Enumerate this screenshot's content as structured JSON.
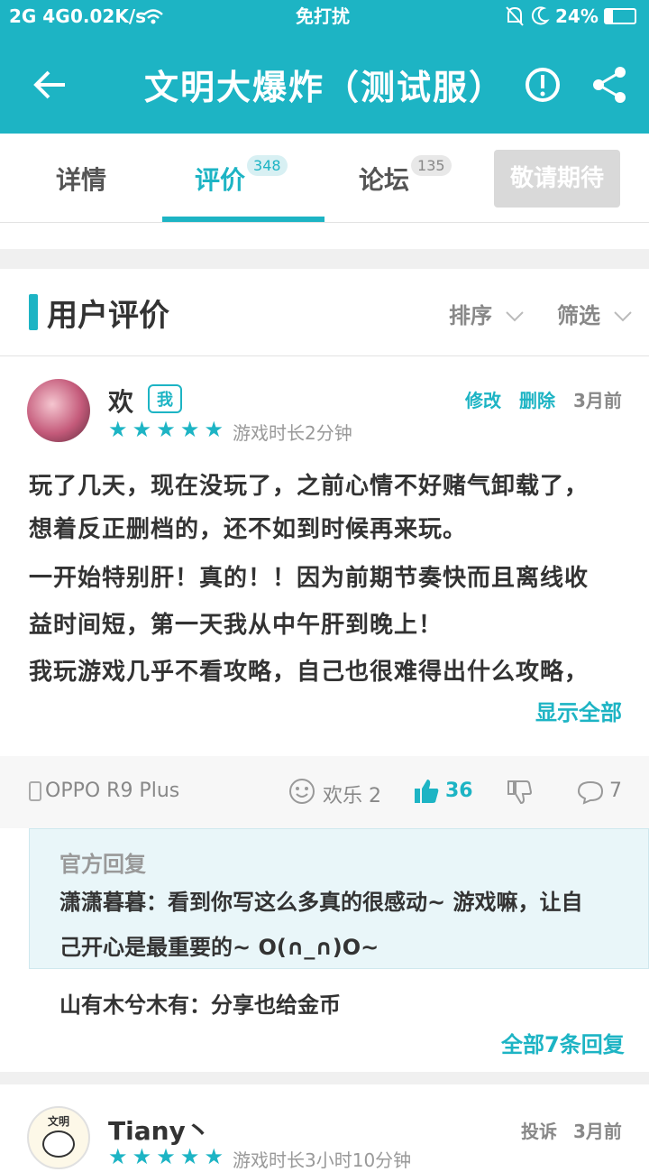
{
  "status_bar": {
    "signal_left": "2G 4G",
    "speed": "0.02K/s",
    "center": "免打扰",
    "battery": "24%"
  },
  "header": {
    "title": "文明大爆炸（测试服）",
    "icons": [
      "back-arrow-icon",
      "report-icon",
      "share-icon"
    ]
  },
  "tabs": [
    {
      "label": "详情",
      "badge": ""
    },
    {
      "label": "评价",
      "badge": "348",
      "active": true
    },
    {
      "label": "论坛",
      "badge": "135"
    }
  ],
  "wait_button": "敬请期待",
  "section": {
    "title": "用户评价",
    "sort_label": "排序",
    "filter_label": "筛选"
  },
  "review1": {
    "username": "欢",
    "me_badge": "我",
    "edit": "修改",
    "delete": "删除",
    "time": "3月前",
    "stars": 5,
    "playtime": "游戏时长2分钟",
    "lines": [
      "玩了几天，现在没玩了，之前心情不好赌气卸载了，",
      "想着反正删档的，还不如到时候再来玩。",
      "一开始特别肝！真的！！因为前期节奏快而且离线收",
      "益时间短，第一天我从中午肝到晚上！",
      "我玩游戏几乎不看攻略，自己也很难得出什么攻略，"
    ],
    "show_all": "显示全部",
    "device": "OPPO R9 Plus",
    "fun_label": "欢乐 2",
    "likes": "36",
    "comments": "7",
    "official_title": "官方回复",
    "official_line1": "潇潇暮暮：看到你写这么多真的很感动~ 游戏嘛，让自",
    "official_line2": "己开心是最重要的~ O(∩_∩)O~",
    "reply2": "山有木兮木有：分享也给金币",
    "all_replies": "全部7条回复"
  },
  "review2": {
    "avatar_text": "文明",
    "username": "Tiany丶",
    "report": "投诉",
    "time": "3月前",
    "playtime": "游戏时长3小时10分钟"
  },
  "colors": {
    "accent": "#1db4c4"
  }
}
